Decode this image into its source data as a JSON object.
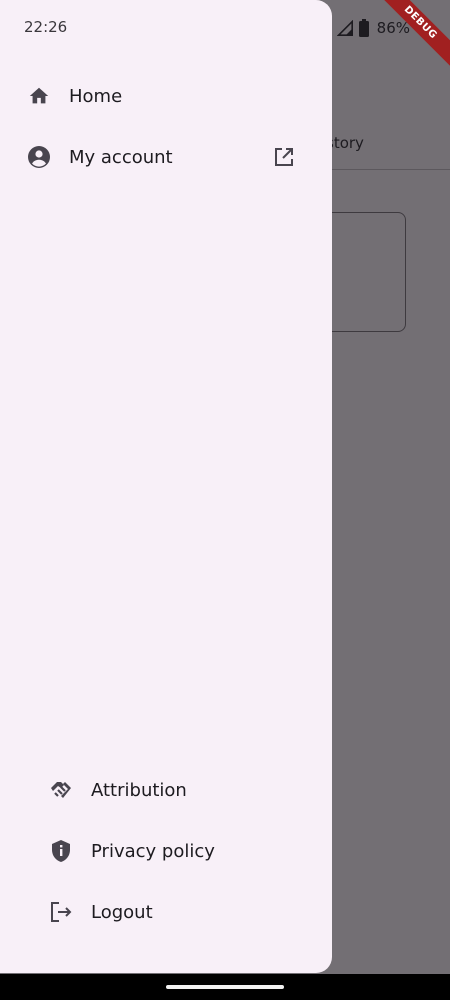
{
  "status_bar": {
    "time": "22:26",
    "battery": "86%"
  },
  "debug_banner": "DEBUG",
  "background": {
    "tab_label": "story"
  },
  "drawer": {
    "top_items": [
      {
        "label": "Home",
        "icon": "home-icon"
      },
      {
        "label": "My account",
        "icon": "account-circle-icon",
        "trailing_icon": "open-in-new-icon"
      }
    ],
    "bottom_items": [
      {
        "label": "Attribution",
        "icon": "handshake-icon"
      },
      {
        "label": "Privacy policy",
        "icon": "shield-icon"
      },
      {
        "label": "Logout",
        "icon": "logout-icon"
      }
    ]
  },
  "colors": {
    "drawer_bg": "#f8f0f8",
    "scrim": "#736f74",
    "text": "#1d1b20"
  }
}
